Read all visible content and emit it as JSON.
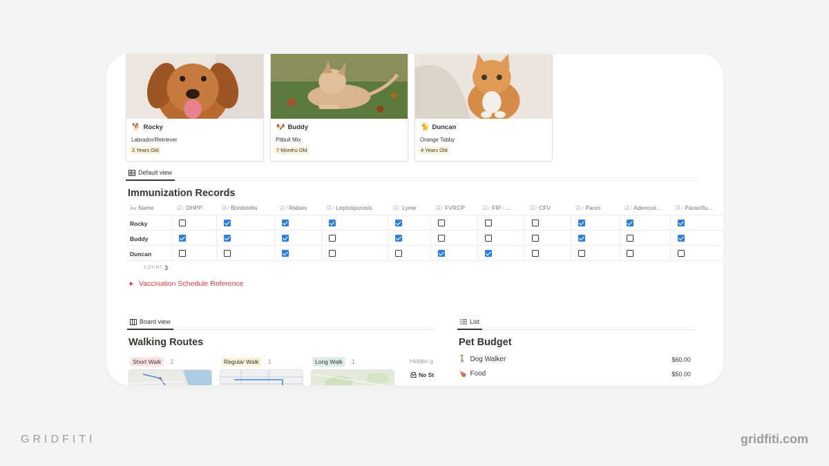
{
  "pets": [
    {
      "icon": "dog-icon",
      "glyph": "🐕",
      "name": "Rocky",
      "breed": "Labrador/Retriever",
      "age": "2 Years Old"
    },
    {
      "icon": "puppy-icon",
      "glyph": "🐶",
      "name": "Buddy",
      "breed": "Pitbull Mix",
      "age": "7 Months Old"
    },
    {
      "icon": "cat-icon",
      "glyph": "🐈",
      "name": "Duncan",
      "breed": "Orange Tabby",
      "age": "4 Years Old"
    }
  ],
  "immunization": {
    "view_label": "Default view",
    "title": "Immunization Records",
    "name_icon": "Aa",
    "name_header": "Name",
    "columns": [
      "DHPP",
      "Bordetella",
      "Rabies",
      "Leptosporosis",
      "Lyme",
      "FVRCP",
      "FIP - ...",
      "CFV",
      "Parvo",
      "Adenovir...",
      "Parainflu..."
    ],
    "rows": [
      {
        "name": "Rocky",
        "values": [
          false,
          true,
          true,
          true,
          true,
          false,
          false,
          false,
          true,
          true,
          true
        ]
      },
      {
        "name": "Buddy",
        "values": [
          true,
          true,
          true,
          false,
          true,
          false,
          false,
          false,
          true,
          false,
          true
        ]
      },
      {
        "name": "Duncan",
        "values": [
          false,
          false,
          true,
          false,
          false,
          true,
          true,
          false,
          false,
          false,
          false
        ]
      }
    ],
    "count_label": "COUNT",
    "count_value": "3",
    "toggle_label": "Vaccination Schedule Reference"
  },
  "walking": {
    "view_label": "Board view",
    "title": "Walking Routes",
    "groups": [
      {
        "label": "Short Walk",
        "count": "2",
        "color": "#fbe4e4"
      },
      {
        "label": "Regular Walk",
        "count": "1",
        "color": "#fbf3db"
      },
      {
        "label": "Long Walk",
        "count": "1",
        "color": "#ddedea"
      }
    ],
    "hidden_label": "Hidden g",
    "no_status_label": "No St"
  },
  "budget": {
    "view_label": "List",
    "title": "Pet Budget",
    "items": [
      {
        "icon": "person-walking-icon",
        "glyph": "🚶",
        "name": "Dog Walker",
        "amount": "$60.00"
      },
      {
        "icon": "drumstick-icon",
        "glyph": "🍗",
        "name": "Food",
        "amount": "$50.00"
      }
    ]
  },
  "brand": {
    "left": "GRIDFITI",
    "right": "gridfiti.com"
  },
  "colors": {
    "checked": "#2f7fd8",
    "toggle": "#e03e3e",
    "page_bg": "#f4f4f4"
  }
}
